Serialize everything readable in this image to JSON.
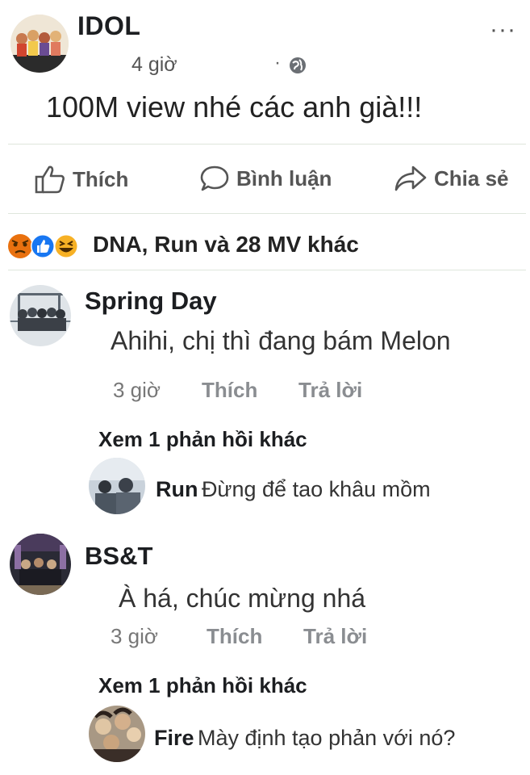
{
  "post": {
    "author": "IDOL",
    "time": "4 giờ",
    "privacy_separator": "·",
    "privacy_icon": "globe-icon",
    "more_label": "···",
    "text": "100M view nhé các anh già!!!"
  },
  "actions": {
    "like": "Thích",
    "comment": "Bình luận",
    "share": "Chia sẻ"
  },
  "reactions": {
    "icons": [
      "angry-icon",
      "like-icon",
      "haha-icon"
    ],
    "summary": "DNA, Run và 28 MV khác"
  },
  "comments": [
    {
      "name": "Spring Day",
      "text": "Ahihi, chị thì đang bám Melon",
      "time": "3 giờ",
      "like": "Thích",
      "reply": "Trả lời",
      "see_more": "Xem 1 phản hồi khác",
      "reply_preview": {
        "name": "Run",
        "text": "Đừng để tao khâu mồm"
      }
    },
    {
      "name": "BS&T",
      "text": "À há, chúc mừng nhá",
      "time": "3 giờ",
      "like": "Thích",
      "reply": "Trả lời",
      "see_more": "Xem 1 phản hồi khác",
      "reply_preview": {
        "name": "Fire",
        "text": "Mày định tạo phản với nó?"
      }
    }
  ],
  "colors": {
    "text": "#1c1e21",
    "muted": "#8a8d91",
    "angry": "#e9710f",
    "like": "#1877f2",
    "haha": "#f7b125"
  }
}
